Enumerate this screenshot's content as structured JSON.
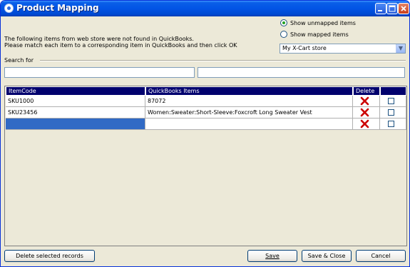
{
  "window": {
    "title": "Product Mapping",
    "controls": [
      "minimize-icon",
      "maximize-icon",
      "close-icon"
    ]
  },
  "instructions": {
    "line1": "The following items from web store were not found in QuickBooks.",
    "line2": "Please match each item to a corresponding item in QuickBooks and then click OK"
  },
  "options": {
    "show_unmapped": "Show unmapped items",
    "show_mapped": "Show mapped items",
    "selected": "show_unmapped"
  },
  "store_select": {
    "value": "My X-Cart store"
  },
  "search": {
    "label": "Search for",
    "itemcode_value": "",
    "qb_value": ""
  },
  "grid": {
    "headers": [
      "ItemCode",
      "QuickBooks Items",
      "Delete",
      ""
    ],
    "rows": [
      {
        "item_code": "SKU1000",
        "qb_item": "87072",
        "delete_icon": "red-x-icon",
        "checked": false
      },
      {
        "item_code": "SKU23456",
        "qb_item": "Women:Sweater:Short-Sleeve:Foxcroft Long Sweater Vest",
        "delete_icon": "red-x-icon",
        "checked": false
      },
      {
        "item_code": "",
        "qb_item": "",
        "delete_icon": "red-x-icon",
        "checked": false,
        "selected": true
      }
    ]
  },
  "buttons": {
    "delete_selected": "Delete selected records",
    "save": "Save",
    "save_close": "Save & Close",
    "cancel": "Cancel"
  },
  "colors": {
    "title_bar": "#0054e3",
    "grid_header": "#01016e",
    "selection": "#316ac5",
    "delete_x": "#cc0000",
    "radio_dot": "#21a121"
  }
}
